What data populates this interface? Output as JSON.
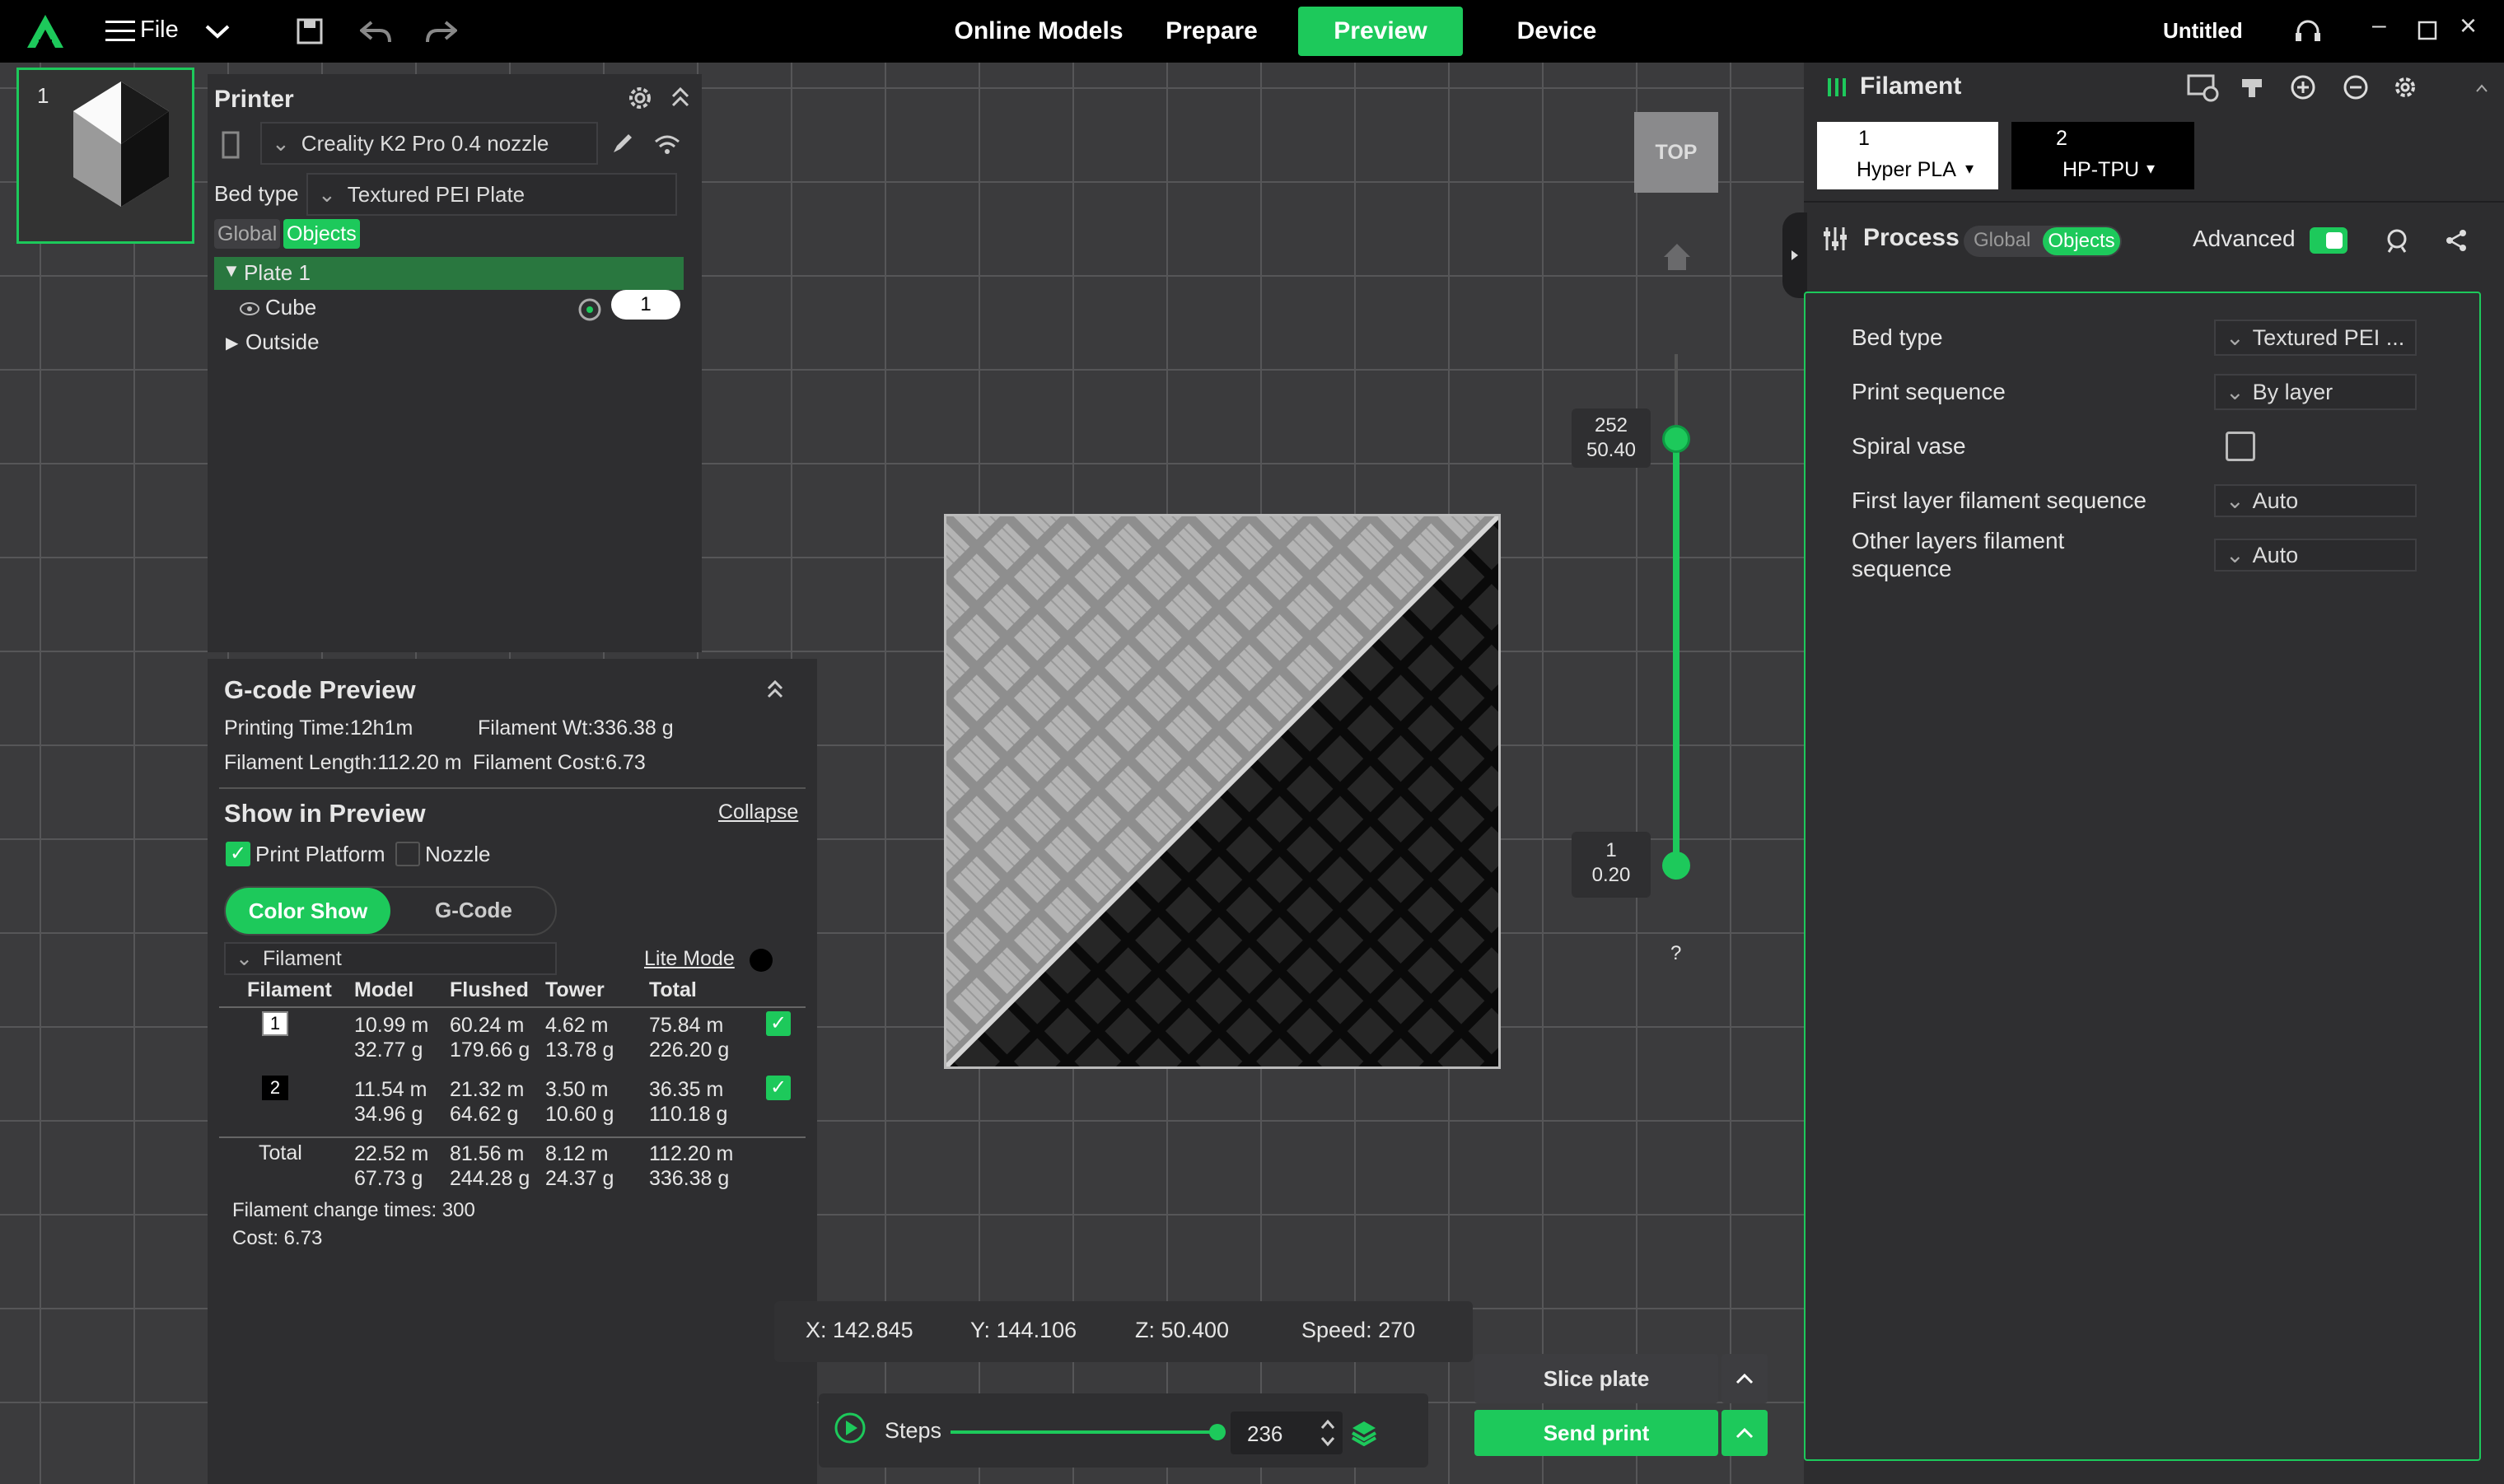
{
  "topbar": {
    "file": "File",
    "tabs": [
      "Online Models",
      "Prepare",
      "Preview",
      "Device"
    ],
    "title": "Untitled"
  },
  "thumb": {
    "index": "1"
  },
  "printer": {
    "title": "Printer",
    "name": "Creality K2 Pro 0.4 nozzle",
    "bed_type_label": "Bed type",
    "bed_type": "Textured PEI Plate",
    "global": "Global",
    "objects": "Objects",
    "plate": "Plate 1",
    "cube": "Cube",
    "cube_count": "1",
    "outside": "Outside"
  },
  "gcode": {
    "title": "G-code Preview",
    "printing_time": "Printing Time:12h1m",
    "filament_wt": "Filament Wt:336.38 g",
    "filament_length": "Filament Length:112.20 m",
    "filament_cost": "Filament Cost:6.73",
    "show_title": "Show in Preview",
    "collapse": "Collapse",
    "print_platform": "Print Platform",
    "nozzle": "Nozzle",
    "color_show": "Color Show",
    "gcode_tab": "G-Code",
    "filament_dd": "Filament",
    "lite_mode": "Lite Mode",
    "headers": [
      "Filament",
      "Model",
      "Flushed",
      "Tower",
      "Total"
    ],
    "rows": [
      {
        "id": "1",
        "model": "10.99 m\n32.77 g",
        "flushed": "60.24 m\n179.66 g",
        "tower": "4.62 m\n13.78 g",
        "total": "75.84 m\n226.20 g"
      },
      {
        "id": "2",
        "model": "11.54 m\n34.96 g",
        "flushed": "21.32 m\n64.62 g",
        "tower": "3.50 m\n10.60 g",
        "total": "36.35 m\n110.18 g"
      },
      {
        "id": "Total",
        "model": "22.52 m\n67.73 g",
        "flushed": "81.56 m\n244.28 g",
        "tower": "8.12 m\n24.37 g",
        "total": "112.20 m\n336.38 g"
      }
    ],
    "change_times": "Filament change times: 300",
    "cost": "Cost: 6.73"
  },
  "view": {
    "top_label": "TOP",
    "layer_top": "252\n50.40",
    "layer_bottom": "1\n0.20",
    "help": "?"
  },
  "status": {
    "x": "X: 142.845",
    "y": "Y: 144.106",
    "z": "Z: 50.400",
    "speed": "Speed: 270"
  },
  "steps": {
    "label": "Steps",
    "value": "236"
  },
  "actions": {
    "slice": "Slice plate",
    "send": "Send print"
  },
  "filament_panel": {
    "title": "Filament",
    "f1_num": "1",
    "f1_name": "Hyper PLA",
    "f2_num": "2",
    "f2_name": "HP-TPU"
  },
  "process": {
    "title": "Process",
    "global": "Global",
    "objects": "Objects",
    "advanced": "Advanced",
    "settings": [
      {
        "label": "Bed type",
        "value": "Textured PEI ..."
      },
      {
        "label": "Print sequence",
        "value": "By layer"
      },
      {
        "label": "Spiral vase",
        "value": ""
      },
      {
        "label": "First layer filament sequence",
        "value": "Auto"
      },
      {
        "label": "Other layers filament sequence",
        "value": "Auto"
      }
    ]
  }
}
